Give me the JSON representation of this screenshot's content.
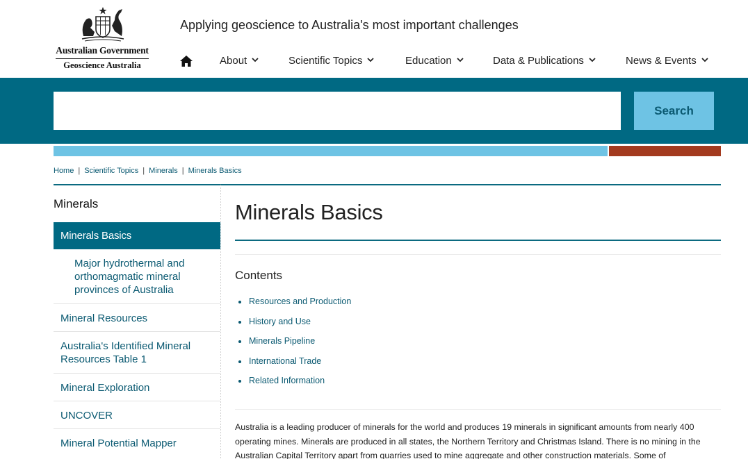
{
  "colors": {
    "teal": "#006983",
    "light_blue": "#6ec3e4",
    "rust": "#a33a1f",
    "link": "#0b5a72"
  },
  "header": {
    "logo": {
      "crest_icon": "coat-of-arms-icon",
      "government": "Australian Government",
      "agency": "Geoscience Australia"
    },
    "tagline": "Applying geoscience to Australia's most important challenges",
    "nav": {
      "home_icon": "home-icon",
      "items": [
        {
          "label": "About"
        },
        {
          "label": "Scientific Topics"
        },
        {
          "label": "Education"
        },
        {
          "label": "Data & Publications"
        },
        {
          "label": "News & Events"
        }
      ]
    }
  },
  "search": {
    "value": "",
    "button_label": "Search"
  },
  "breadcrumb": [
    "Home",
    "Scientific Topics",
    "Minerals",
    "Minerals Basics"
  ],
  "sidebar": {
    "title": "Minerals",
    "active": "Minerals Basics",
    "sub_item": "Major hydrothermal and orthomagmatic mineral provinces of Australia",
    "items": [
      "Mineral Resources",
      "Australia's Identified Mineral Resources Table 1",
      "Mineral Exploration",
      "UNCOVER",
      "Mineral Potential Mapper"
    ]
  },
  "main": {
    "title": "Minerals Basics",
    "contents_heading": "Contents",
    "contents": [
      "Resources and Production",
      "History and Use",
      "Minerals Pipeline",
      "International Trade",
      "Related Information"
    ],
    "body": "Australia is a leading producer of minerals for the world and produces 19 minerals in significant amounts from nearly 400 operating mines. Minerals are produced in all states, the Northern Territory and Christmas Island. There is no mining in the Australian Capital Territory apart from quarries used to mine aggregate and other construction materials. Some of"
  }
}
